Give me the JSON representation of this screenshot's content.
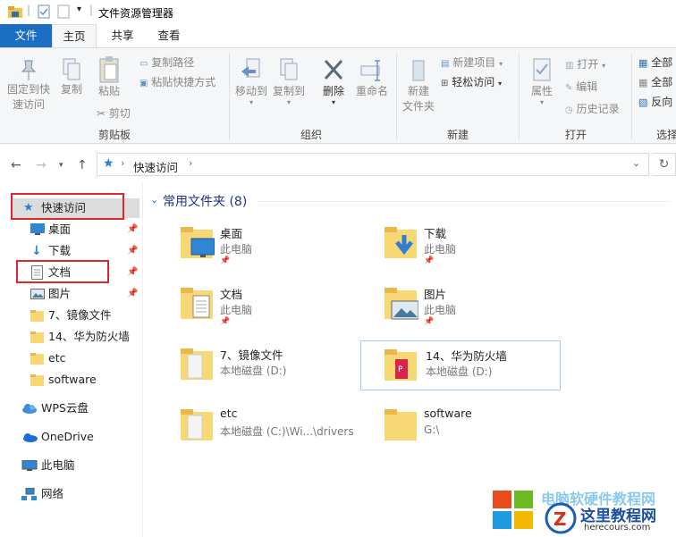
{
  "window": {
    "title": "文件资源管理器"
  },
  "tabs": {
    "file": "文件",
    "home": "主页",
    "share": "共享",
    "view": "查看"
  },
  "ribbon": {
    "clipboard": {
      "pin": "固定到快\n速访问",
      "copy": "复制",
      "paste": "粘贴",
      "copy_path": "复制路径",
      "paste_shortcut": "粘贴快捷方式",
      "cut": "剪切",
      "group": "剪贴板"
    },
    "organize": {
      "move_to": "移动到",
      "copy_to": "复制到",
      "delete": "删除",
      "rename": "重命名",
      "group": "组织"
    },
    "new": {
      "new_folder": "新建\n文件夹",
      "new_item": "新建项目",
      "easy_access": "轻松访问",
      "group": "新建"
    },
    "open": {
      "properties": "属性",
      "open": "打开",
      "edit": "编辑",
      "history": "历史记录",
      "group": "打开"
    },
    "select": {
      "select_all": "全部",
      "select_none": "全部",
      "invert": "反向",
      "group": "选择"
    }
  },
  "address": {
    "location": "快速访问"
  },
  "nav": {
    "quick_access": "快速访问",
    "items": [
      "桌面",
      "下载",
      "文档",
      "图片",
      "7、镜像文件",
      "14、华为防火墙",
      "etc",
      "software"
    ],
    "wps": "WPS云盘",
    "onedrive": "OneDrive",
    "this_pc": "此电脑",
    "network": "网络"
  },
  "content": {
    "section_header": "常用文件夹 (8)",
    "folders": [
      {
        "name": "桌面",
        "location": "此电脑"
      },
      {
        "name": "下载",
        "location": "此电脑"
      },
      {
        "name": "文档",
        "location": "此电脑"
      },
      {
        "name": "图片",
        "location": "此电脑"
      },
      {
        "name": "7、镜像文件",
        "location": "本地磁盘 (D:)"
      },
      {
        "name": "14、华为防火墙",
        "location": "本地磁盘 (D:)"
      },
      {
        "name": "etc",
        "location": "本地磁盘 (C:)\\Wi...\\drivers"
      },
      {
        "name": "software",
        "location": "G:\\"
      }
    ]
  },
  "watermark": {
    "text": "这里教程网",
    "url": "herecours.com",
    "top": "电脑软硬件教程网"
  },
  "colors": {
    "accent": "#1c6ec4",
    "folder": "#f8d775",
    "highlight": "#e0262a"
  }
}
